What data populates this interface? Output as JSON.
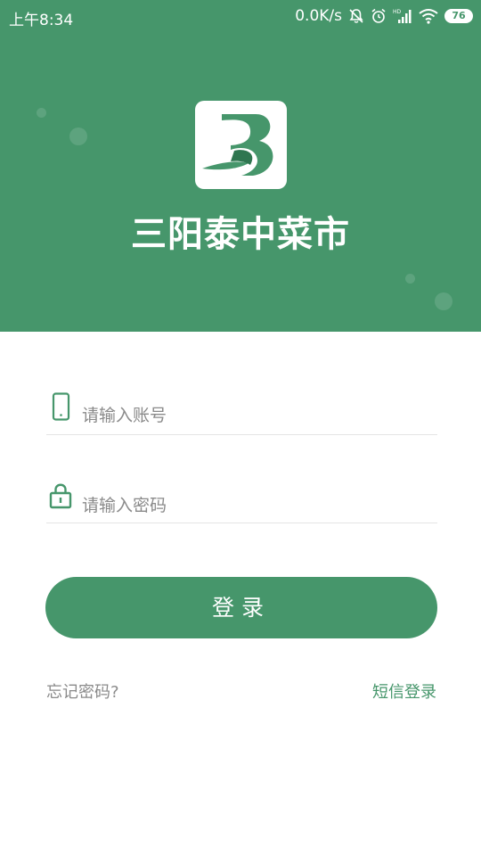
{
  "status_bar": {
    "time": "上午8:34",
    "network_speed": "0.0K/s",
    "battery_level": "76"
  },
  "app": {
    "title": "三阳泰中菜市",
    "brand_color": "#46966b"
  },
  "login_form": {
    "account_placeholder": "请输入账号",
    "password_placeholder": "请输入密码",
    "login_button": "登录",
    "forgot_password": "忘记密码?",
    "sms_login": "短信登录"
  },
  "icons": {
    "account": "phone-icon",
    "password": "lock-icon",
    "logo": "b-logo-icon"
  }
}
